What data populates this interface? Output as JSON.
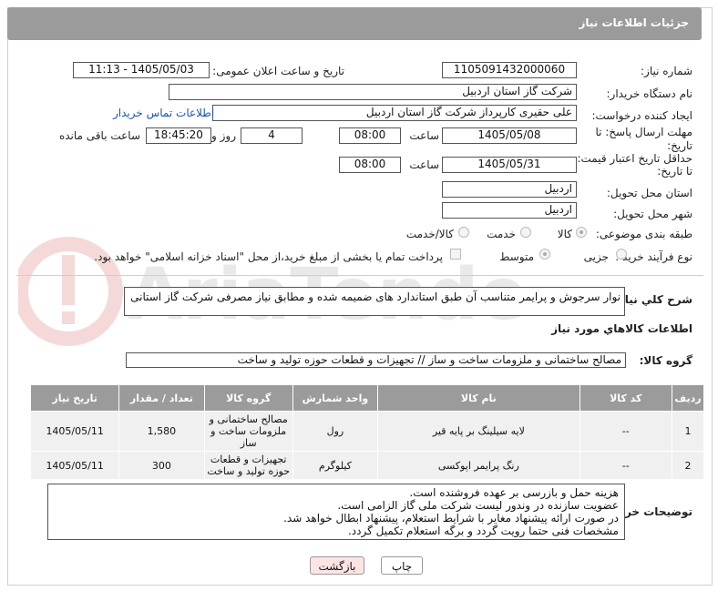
{
  "header": {
    "title": "جزئیات اطلاعات نیاز"
  },
  "fields": {
    "need_number_label": "شماره نیاز:",
    "need_number": "1105091432000060",
    "announce_label": "تاریخ و ساعت اعلان عمومی:",
    "announce_value": "1405/05/03 - 11:13",
    "buyer_org_label": "نام دستگاه خریدار:",
    "buyer_org": "شرکت گاز استان اردبیل",
    "creator_label": "ایجاد کننده درخواست:",
    "creator": "علی حقیری کارپرداز شرکت گاز استان اردبیل",
    "contact_link": "اطلاعات تماس خریدار",
    "deadline_label_1": "مهلت ارسال پاسخ: تا",
    "deadline_label_2": "تاریخ:",
    "deadline_date": "1405/05/08",
    "hour_label": "ساعت",
    "deadline_time": "08:00",
    "days_value": "4",
    "days_label": "روز و",
    "remaining_time": "18:45:20",
    "remaining_label": "ساعت باقی مانده",
    "validity_label_1": "حداقل تاریخ اعتبار قیمت:",
    "validity_label_2": "تا تاریخ:",
    "validity_date": "1405/05/31",
    "validity_time": "08:00",
    "province_label": "استان محل تحویل:",
    "province": "اردبیل",
    "city_label": "شهر محل تحویل:",
    "city": "اردبیل",
    "category_label": "طبقه بندی موضوعی:",
    "category_options": [
      "کالا",
      "خدمت",
      "کالا/خدمت"
    ],
    "process_label": "نوع فرآیند خرید :",
    "process_options": [
      "جزیی",
      "متوسط"
    ],
    "payment_text": "پرداخت تمام یا بخشی از مبلغ خرید،از محل \"اسناد خزانه اسلامی\" خواهد بود."
  },
  "description": {
    "label": "شرح کلي نياز:",
    "text": "نوار سرجوش و پرایمر متناسب آن طبق استاندارد های ضمیمه شده و مطابق نیاز مصرفی شرکت گاز استانی"
  },
  "goods": {
    "section_title": "اطلاعات کالاهاي مورد نياز",
    "group_label": "گروه کالا:",
    "group_value": "مصالح ساختمانی و ملزومات ساخت و ساز // تجهیزات و قطعات حوزه تولید و ساخت",
    "columns": [
      "ردیف",
      "کد کالا",
      "نام کالا",
      "واحد شمارش",
      "گروه کالا",
      "تعداد / مقدار",
      "تاریخ نیاز"
    ],
    "rows": [
      {
        "row": "1",
        "code": "--",
        "name": "لایه سیلینگ بر پایه قیر",
        "unit": "رول",
        "group": "مصالح ساختمانی و ملزومات ساخت و ساز",
        "qty": "1,580",
        "date": "1405/05/11"
      },
      {
        "row": "2",
        "code": "--",
        "name": "رنگ پرایمر اپوکسی",
        "unit": "کیلوگرم",
        "group": "تجهیزات و قطعات حوزه تولید و ساخت",
        "qty": "300",
        "date": "1405/05/11"
      }
    ]
  },
  "buyer_notes": {
    "label": "توضیحات خریدار:",
    "lines": [
      "هزینه حمل و بازرسی بر عهده فروشنده است.",
      "عضویت سازنده در وندور لیست شرکت ملی گاز الزامی است.",
      "در صورت ارائه پیشنهاد مغایر با شرایط استعلام، پیشنهاد ابطال خواهد شد.",
      "مشخصات فنی حتما رویت گردد و برگه استعلام تکمیل گردد."
    ]
  },
  "buttons": {
    "print": "چاپ",
    "back": "بازگشت"
  },
  "colors": {
    "header_bg": "#9b9b9b",
    "link": "#1a55b5",
    "back_btn_bg": "#fde4e4"
  }
}
